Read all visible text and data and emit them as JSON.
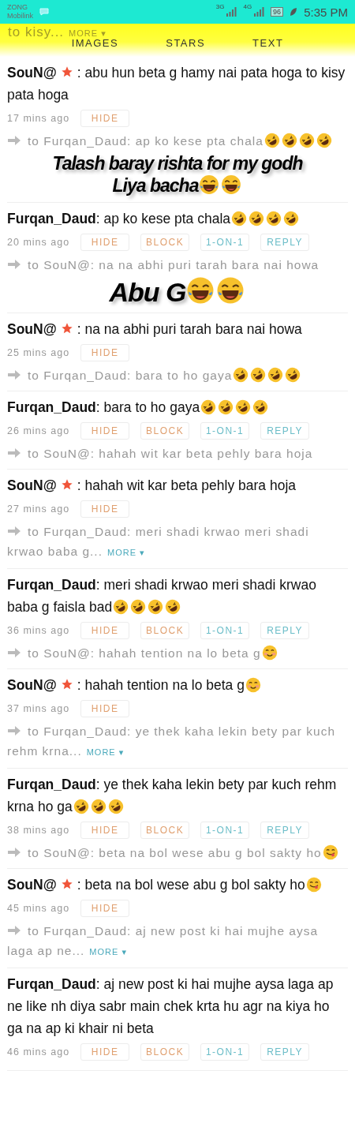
{
  "status_bar": {
    "carriers": [
      "ZONG",
      "Mobilink"
    ],
    "networks": [
      "3G",
      "4G"
    ],
    "battery": "96",
    "time": "5:35 PM"
  },
  "header": {
    "faded_text": "to kisy...",
    "faded_more": "MORE ▾",
    "tabs": [
      {
        "label": "IMAGES",
        "selected": false
      },
      {
        "label": "STARS",
        "selected": false
      },
      {
        "label": "TEXT",
        "selected": false
      }
    ]
  },
  "messages": [
    {
      "author": "SouN@",
      "starred": true,
      "text": ": abu hun beta g hamy nai pata hoga to kisy pata hoga",
      "time": "17 mins ago",
      "buttons": [
        {
          "kind": "hide",
          "label": "HIDE"
        }
      ],
      "reply": {
        "text": "to Furqan_Daud: ap ko kese pta chala",
        "emojis": [
          {
            "kind": "rofl"
          },
          {
            "kind": "rofl"
          },
          {
            "kind": "rofl"
          },
          {
            "kind": "rofl"
          }
        ]
      },
      "sticker": {
        "lines": [
          "Talash baray rishta for my godh",
          "Liya  bacha"
        ],
        "emojis": [
          {
            "kind": "joy"
          },
          {
            "kind": "joy"
          }
        ]
      }
    },
    {
      "author": "Furqan_Daud",
      "starred": false,
      "text": ": ap ko kese pta chala",
      "emojis": [
        {
          "kind": "rofl"
        },
        {
          "kind": "rofl"
        },
        {
          "kind": "rofl"
        },
        {
          "kind": "rofl"
        }
      ],
      "time": "20 mins ago",
      "buttons": [
        {
          "kind": "hide",
          "label": "HIDE"
        },
        {
          "kind": "block",
          "label": "BLOCK"
        },
        {
          "kind": "private",
          "label": "1-ON-1"
        },
        {
          "kind": "reply",
          "label": "REPLY"
        }
      ],
      "reply": {
        "text": "to SouN@: na na abhi puri tarah bara nai howa"
      },
      "sticker": {
        "lines": [
          "Abu G"
        ],
        "emojis": [
          {
            "kind": "joy"
          },
          {
            "kind": "joy"
          }
        ]
      }
    },
    {
      "author": "SouN@",
      "starred": true,
      "text": ": na na abhi puri tarah bara nai howa",
      "time": "25 mins ago",
      "buttons": [
        {
          "kind": "hide",
          "label": "HIDE"
        }
      ],
      "reply": {
        "text": "to Furqan_Daud: bara to ho gaya",
        "emojis": [
          {
            "kind": "rofl"
          },
          {
            "kind": "rofl"
          },
          {
            "kind": "rofl"
          },
          {
            "kind": "rofl"
          }
        ]
      }
    },
    {
      "author": "Furqan_Daud",
      "starred": false,
      "text": ": bara to ho gaya",
      "emojis": [
        {
          "kind": "rofl"
        },
        {
          "kind": "rofl"
        },
        {
          "kind": "rofl"
        },
        {
          "kind": "rofl"
        }
      ],
      "time": "26 mins ago",
      "buttons": [
        {
          "kind": "hide",
          "label": "HIDE"
        },
        {
          "kind": "block",
          "label": "BLOCK"
        },
        {
          "kind": "private",
          "label": "1-ON-1"
        },
        {
          "kind": "reply",
          "label": "REPLY"
        }
      ],
      "reply": {
        "text": "to SouN@: hahah wit kar beta pehly bara hoja"
      }
    },
    {
      "author": "SouN@",
      "starred": true,
      "text": ": hahah wit kar beta pehly bara hoja",
      "time": "27 mins ago",
      "buttons": [
        {
          "kind": "hide",
          "label": "HIDE"
        }
      ],
      "reply": {
        "text": "to Furqan_Daud: meri shadi krwao meri shadi krwao baba g...",
        "more": "MORE ▾"
      }
    },
    {
      "author": "Furqan_Daud",
      "starred": false,
      "text": ": meri shadi krwao meri shadi krwao baba g faisla bad",
      "emojis": [
        {
          "kind": "rofl"
        },
        {
          "kind": "rofl"
        },
        {
          "kind": "rofl"
        },
        {
          "kind": "rofl"
        }
      ],
      "time": "36 mins ago",
      "buttons": [
        {
          "kind": "hide",
          "label": "HIDE"
        },
        {
          "kind": "block",
          "label": "BLOCK"
        },
        {
          "kind": "private",
          "label": "1-ON-1"
        },
        {
          "kind": "reply",
          "label": "REPLY"
        }
      ],
      "reply": {
        "text": "to SouN@: hahah tention na lo beta g",
        "emojis": [
          {
            "kind": "smiling"
          }
        ]
      }
    },
    {
      "author": "SouN@",
      "starred": true,
      "text": ": hahah tention na lo beta g",
      "emojis": [
        {
          "kind": "smiling"
        }
      ],
      "time": "37 mins ago",
      "buttons": [
        {
          "kind": "hide",
          "label": "HIDE"
        }
      ],
      "reply": {
        "text": "to Furqan_Daud: ye thek kaha lekin bety par kuch rehm krna...",
        "more": "MORE ▾"
      }
    },
    {
      "author": "Furqan_Daud",
      "starred": false,
      "text": ": ye thek kaha lekin bety par kuch rehm krna ho ga",
      "emojis": [
        {
          "kind": "rofl"
        },
        {
          "kind": "rofl"
        },
        {
          "kind": "rofl"
        }
      ],
      "time": "38 mins ago",
      "buttons": [
        {
          "kind": "hide",
          "label": "HIDE"
        },
        {
          "kind": "block",
          "label": "BLOCK"
        },
        {
          "kind": "private",
          "label": "1-ON-1"
        },
        {
          "kind": "reply",
          "label": "REPLY"
        }
      ],
      "reply": {
        "text": "to SouN@: beta na bol wese abu g bol sakty ho",
        "emojis": [
          {
            "kind": "yum"
          }
        ]
      }
    },
    {
      "author": "SouN@",
      "starred": true,
      "text": ": beta na bol wese abu g bol sakty ho",
      "emojis": [
        {
          "kind": "yum"
        }
      ],
      "time": "45 mins ago",
      "buttons": [
        {
          "kind": "hide",
          "label": "HIDE"
        }
      ],
      "reply": {
        "text": "to Furqan_Daud: aj new post ki hai mujhe aysa laga ap ne...",
        "more": "MORE ▾"
      }
    },
    {
      "author": "Furqan_Daud",
      "starred": false,
      "text": ": aj new post ki hai mujhe aysa laga ap ne like nh diya sabr main chek krta hu agr na kiya ho ga na ap ki khair ni beta",
      "time": "46 mins ago",
      "buttons": [
        {
          "kind": "hide",
          "label": "HIDE"
        },
        {
          "kind": "block",
          "label": "BLOCK"
        },
        {
          "kind": "private",
          "label": "1-ON-1"
        },
        {
          "kind": "reply",
          "label": "REPLY"
        }
      ]
    }
  ]
}
